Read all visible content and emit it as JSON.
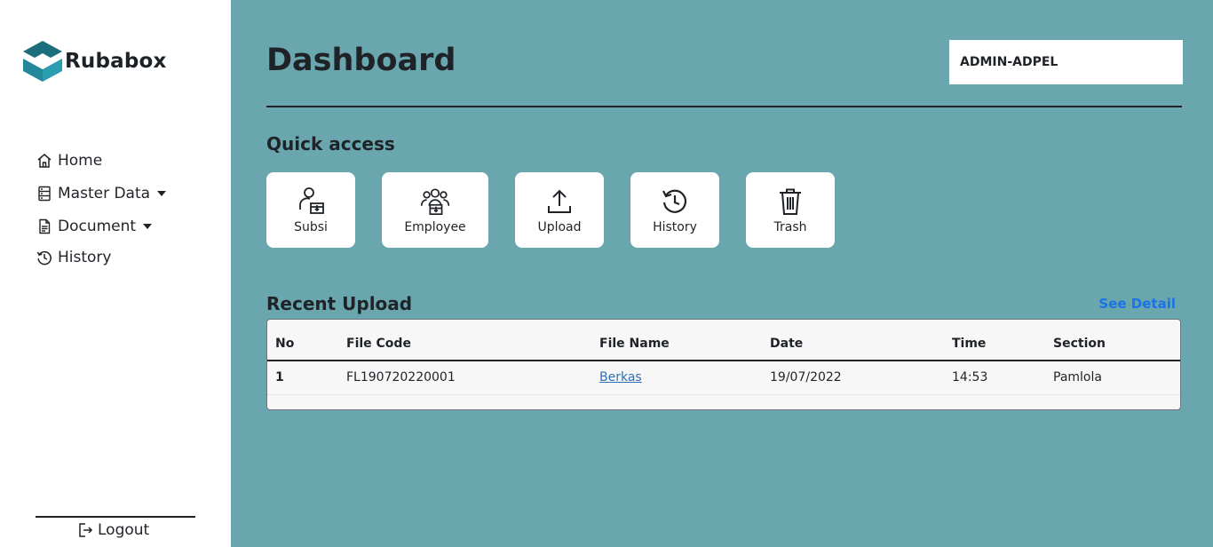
{
  "app": {
    "name": "Rubabox"
  },
  "sidebar": {
    "items": [
      {
        "label": "Home",
        "icon": "home-icon"
      },
      {
        "label": "Master Data",
        "icon": "database-icon",
        "dropdown": true
      },
      {
        "label": "Document",
        "icon": "document-icon",
        "dropdown": true
      },
      {
        "label": "History",
        "icon": "history-icon"
      }
    ],
    "logout_label": "Logout"
  },
  "header": {
    "title": "Dashboard",
    "user": "ADMIN-ADPEL"
  },
  "quick_access": {
    "title": "Quick access",
    "items": [
      {
        "label": "Subsi",
        "icon": "user-box-icon"
      },
      {
        "label": "Employee",
        "icon": "users-box-icon"
      },
      {
        "label": "Upload",
        "icon": "upload-icon"
      },
      {
        "label": "History",
        "icon": "history-icon"
      },
      {
        "label": "Trash",
        "icon": "trash-icon"
      }
    ]
  },
  "recent_upload": {
    "title": "Recent Upload",
    "see_detail_label": "See Detail",
    "columns": [
      "No",
      "File Code",
      "File Name",
      "Date",
      "Time",
      "Section"
    ],
    "rows": [
      {
        "no": "1",
        "file_code": "FL190720220001",
        "file_name": "Berkas",
        "date": "19/07/2022",
        "time": "14:53",
        "section": "Pamlola"
      }
    ]
  },
  "colors": {
    "background": "#69a6ae",
    "sidebar": "#ffffff",
    "link": "#1a73e8",
    "logo_dark": "#1b6f7d",
    "logo_light": "#2a9db0"
  }
}
